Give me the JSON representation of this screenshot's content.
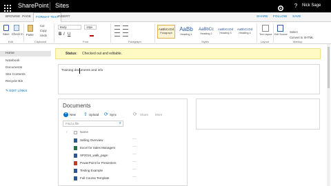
{
  "suitebar": {
    "app_title": "SharePoint",
    "section": "Sites",
    "user_name": "Nick Sage",
    "help_icon": "help-icon",
    "settings_icon": "gear-icon"
  },
  "ribbon_tabs": [
    "BROWSE",
    "PAGE",
    "FORMAT TEXT",
    "INSERT"
  ],
  "ribbon_right": [
    "SHARE",
    "FOLLOW",
    "SAVE"
  ],
  "ribbon": {
    "save_label": "Save",
    "checkin_label": "Check In",
    "paste_label": "Paste",
    "cut_label": "Cut",
    "copy_label": "Copy",
    "undo_label": "Undo",
    "font_name": "Body",
    "font_size": "13px",
    "styles": [
      {
        "sample": "AaBbCcDd",
        "label": "Paragraph"
      },
      {
        "sample": "AaBb",
        "label": "Heading 1"
      },
      {
        "sample": "AaBbCc",
        "label": "Heading 2"
      },
      {
        "sample": "AaBbCcDd",
        "label": "Heading 3"
      },
      {
        "sample": "AaBbCcDd",
        "label": "Heading 4"
      }
    ],
    "text_layout_label": "Text Layout",
    "edit_source_label": "Edit Source",
    "select_label": "Select",
    "convert_label": "Convert to XHTML",
    "groups": [
      "Edit",
      "Clipboard",
      "Font",
      "Paragraph",
      "Styles",
      "Layout",
      "Markup"
    ]
  },
  "status": {
    "label": "Status:",
    "text": "Checked out and editable."
  },
  "nav": [
    "Home",
    "Notebook",
    "Documents",
    "Site Contents",
    "Recycle Bin"
  ],
  "nav_edit_links": "EDIT LINKS",
  "editor_text": "Training documents and info",
  "documents": {
    "title": "Documents",
    "new_label": "New",
    "upload_label": "Upload",
    "sync_label": "Sync",
    "share_label": "Share",
    "more_label": "More",
    "search_placeholder": "Find a file",
    "column_name": "Name",
    "files": [
      "Selling Overview",
      "Excel for Sales Managers",
      "SP2016_walk_page",
      "PowerPoint for Presenters",
      "Testing Example",
      "Full Course Template"
    ]
  }
}
